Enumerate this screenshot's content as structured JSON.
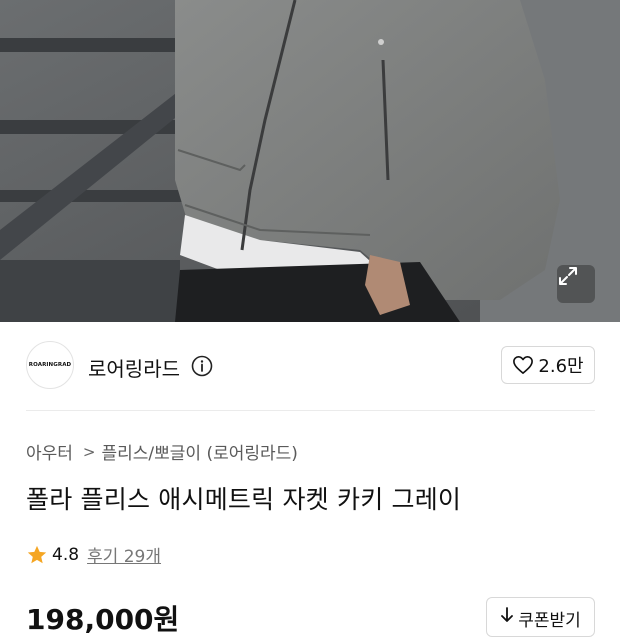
{
  "hero": {
    "alt": "product-photo-fleece-jacket"
  },
  "brand": {
    "logo_text": "ROARINGRAD",
    "name": "로어링라드",
    "likes": "2.6만"
  },
  "breadcrumb": {
    "category": "아우터",
    "subcategory": "플리스/뽀글이 (로어링라드)"
  },
  "product": {
    "title": "폴라 플리스 애시메트릭 자켓 카키 그레이",
    "rating": "4.8",
    "reviews": "후기 29개",
    "price": "198,000원"
  },
  "coupon": {
    "label": "쿠폰받기"
  },
  "colors": {
    "star": "#f5a623",
    "text": "#111111",
    "muted": "#777777"
  }
}
